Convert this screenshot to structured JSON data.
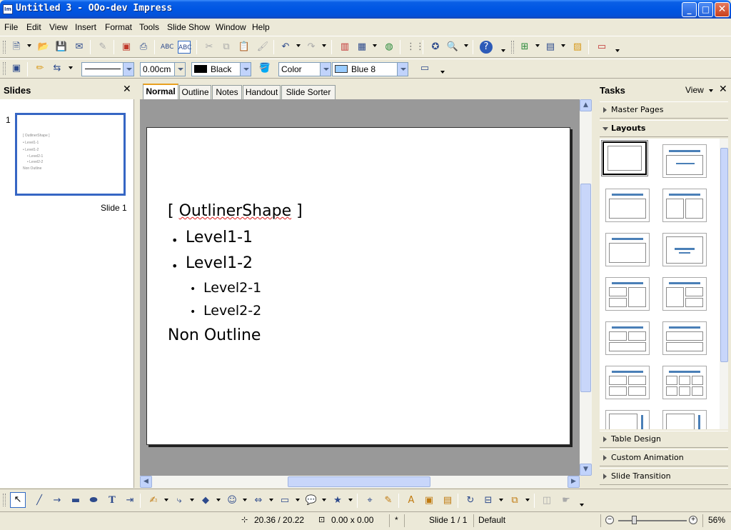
{
  "window": {
    "title": "Untitled 3 - OOo-dev Impress",
    "app_icon_text": "Im",
    "minimize_glyph": "_",
    "maximize_glyph": "□",
    "close_glyph": "✕"
  },
  "menu": [
    "File",
    "Edit",
    "View",
    "Insert",
    "Format",
    "Tools",
    "Slide Show",
    "Window",
    "Help"
  ],
  "line_toolbar": {
    "line_width": "0.00cm",
    "line_color": "Black",
    "area_style": "Color",
    "area_color": "Blue 8",
    "line_color_swatch": "#000000",
    "area_color_swatch": "#99ccff"
  },
  "slides_pane": {
    "title": "Slides",
    "close_glyph": "✕",
    "thumbnail_number": "1",
    "thumbnail_caption": "Slide 1",
    "thumbnail_lines": [
      "[ OutlinerShape ]",
      "• Level1-1",
      "• Level1-2",
      "• Level2-1",
      "• Level2-2",
      "Non Outline"
    ]
  },
  "view_tabs": [
    "Normal",
    "Outline",
    "Notes",
    "Handout",
    "Slide Sorter"
  ],
  "active_view_tab": "Normal",
  "slide": {
    "outliner_open": "[ ",
    "outliner_word": "OutlinerShape",
    "outliner_close": " ]",
    "level1": [
      "Level1-1",
      "Level1-2"
    ],
    "level2": [
      "Level2-1",
      "Level2-2"
    ],
    "bullet": "•",
    "non_outline": "Non Outline"
  },
  "tasks_pane": {
    "title": "Tasks",
    "view_label": "View",
    "close_glyph": "✕",
    "sections": {
      "master_pages": "Master Pages",
      "layouts": "Layouts",
      "table_design": "Table Design",
      "custom_animation": "Custom Animation",
      "slide_transition": "Slide Transition"
    }
  },
  "statusbar": {
    "position": "20.36 / 20.22",
    "size": "0.00 x 0.00",
    "modified": "*",
    "slide_info": "Slide 1 / 1",
    "master": "Default",
    "zoom": "56%",
    "zoom_out": "−",
    "zoom_in": "+"
  },
  "colors": {
    "titlebar": "#0056e3",
    "chrome": "#ece9d8",
    "canvas": "#999999",
    "selection": "#3666c4",
    "layout_bar": "#4a7fb7"
  }
}
